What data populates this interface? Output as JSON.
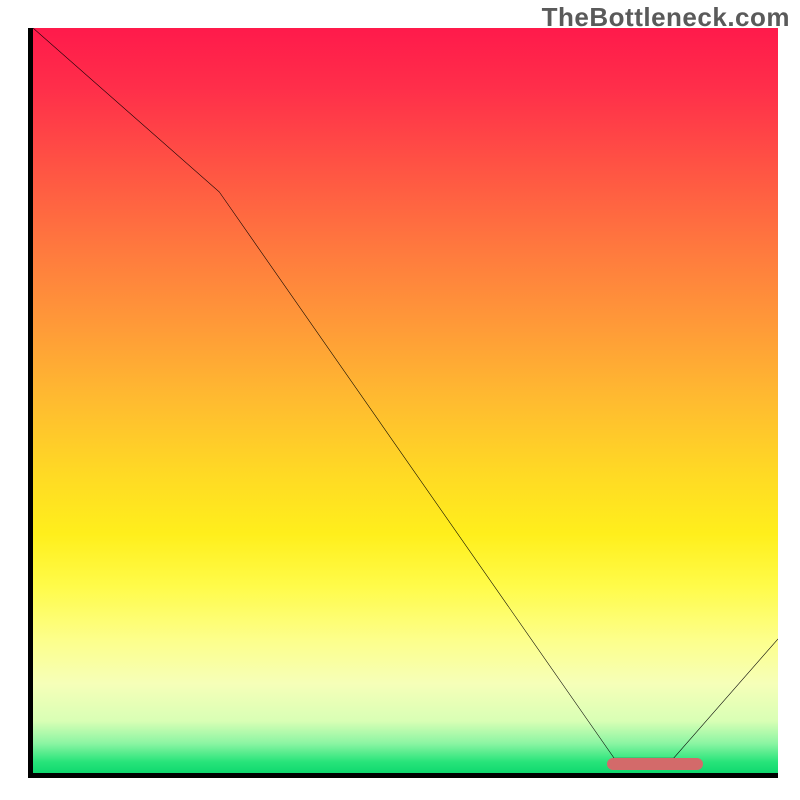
{
  "attribution": "TheBottleneck.com",
  "chart_data": {
    "type": "line",
    "title": "",
    "xlabel": "",
    "ylabel": "",
    "xlim": [
      0,
      100
    ],
    "ylim": [
      0,
      100
    ],
    "grid": false,
    "legend": null,
    "background": {
      "kind": "vertical-gradient",
      "meaning": "bottleneck severity (top=red=high, bottom=green=none)",
      "stops": [
        {
          "pos": 0.0,
          "color": "#ff1a4b"
        },
        {
          "pos": 0.5,
          "color": "#ffbb30"
        },
        {
          "pos": 0.75,
          "color": "#fffb4a"
        },
        {
          "pos": 0.96,
          "color": "#8cf5a3"
        },
        {
          "pos": 1.0,
          "color": "#0fd86e"
        }
      ]
    },
    "series": [
      {
        "name": "bottleneck-curve",
        "x": [
          0,
          25,
          78,
          86,
          100
        ],
        "values": [
          100,
          78,
          2,
          2,
          18
        ]
      }
    ],
    "optimal_marker": {
      "x_start": 77,
      "x_end": 90,
      "y": 1
    }
  }
}
